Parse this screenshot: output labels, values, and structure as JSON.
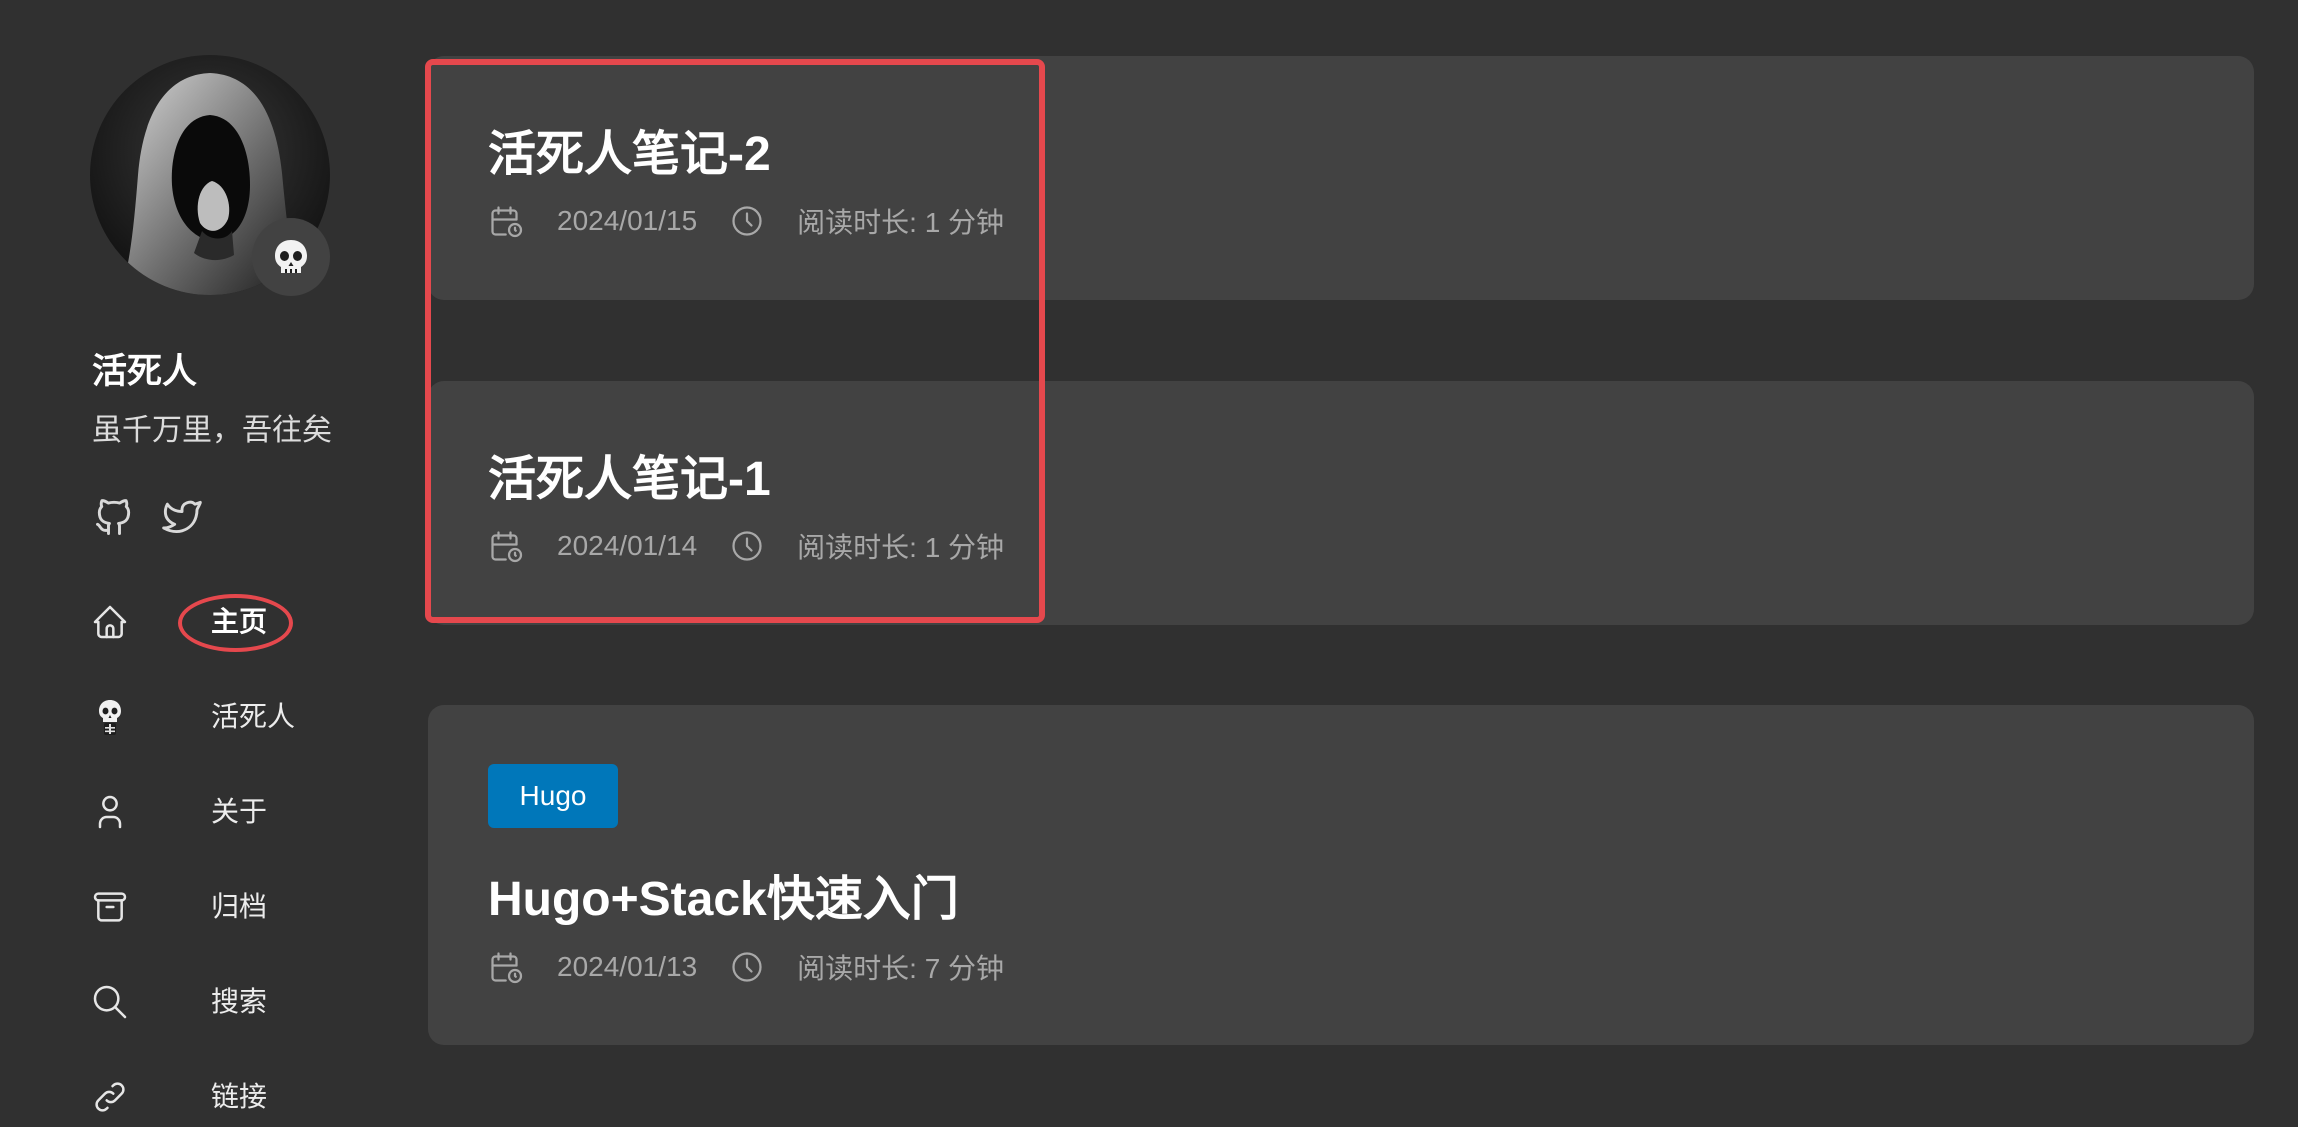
{
  "sidebar": {
    "site_name": "活死人",
    "site_description": "虽千万里，吾往矣",
    "avatar_emoji": "💀",
    "social": [
      "github-icon",
      "twitter-icon"
    ],
    "menu": [
      {
        "label": "主页",
        "icon": "home-icon",
        "active": true
      },
      {
        "label": "活死人",
        "icon": "skeleton-icon"
      },
      {
        "label": "关于",
        "icon": "user-icon"
      },
      {
        "label": "归档",
        "icon": "archive-icon"
      },
      {
        "label": "搜索",
        "icon": "search-icon"
      },
      {
        "label": "链接",
        "icon": "link-icon"
      }
    ]
  },
  "articles": [
    {
      "title": "活死人笔记-2",
      "date": "2024/01/15",
      "reading_time": "阅读时长: 1 分钟"
    },
    {
      "title": "活死人笔记-1",
      "date": "2024/01/14",
      "reading_time": "阅读时长: 1 分钟"
    },
    {
      "tag": "Hugo",
      "title": "Hugo+Stack快速入门",
      "date": "2024/01/13",
      "reading_time": "阅读时长: 7 分钟"
    }
  ],
  "colors": {
    "background": "#303030",
    "card": "#424242",
    "tag": "#0077ba",
    "annotation": "#e5484d"
  }
}
